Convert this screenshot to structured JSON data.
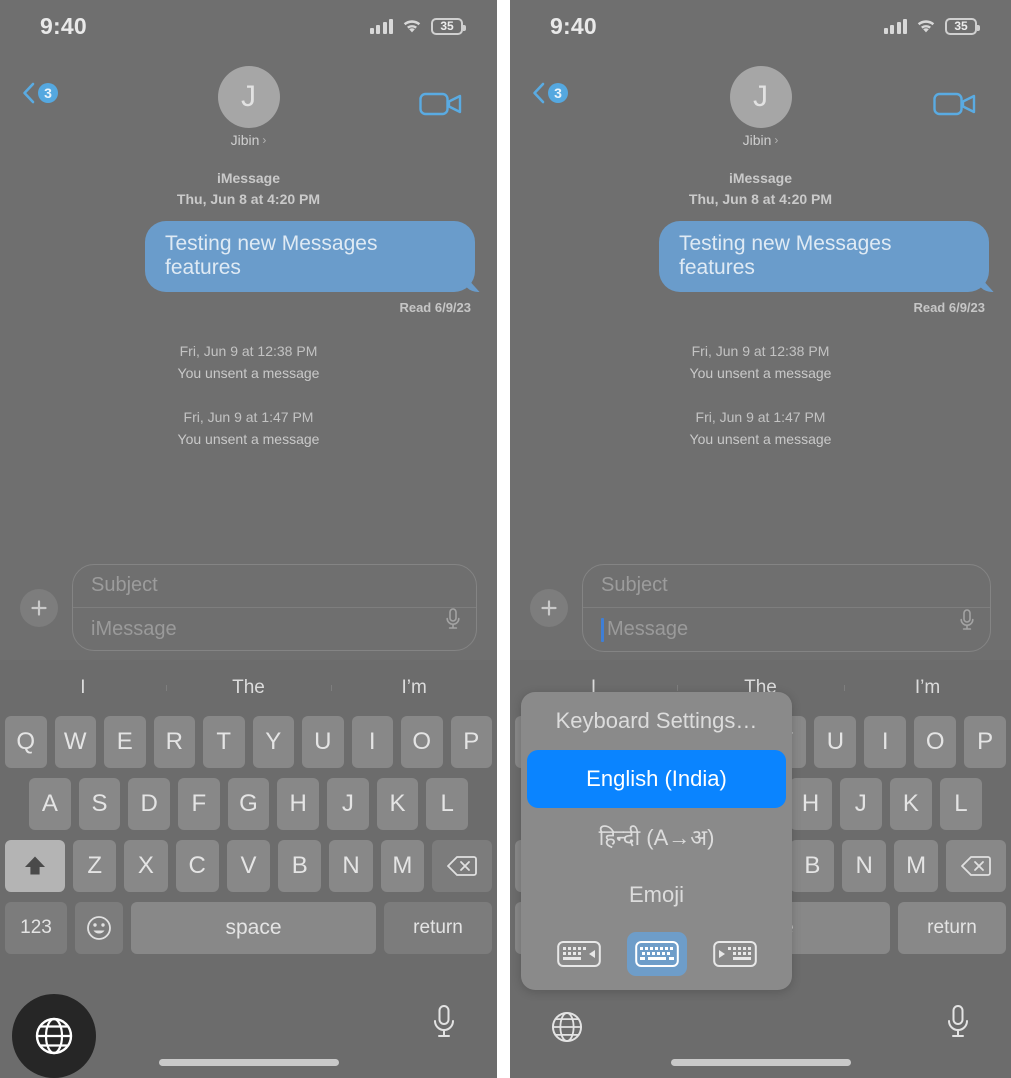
{
  "status_bar": {
    "time": "9:40",
    "battery_level": "35",
    "signal_icon": "cellular-signal-icon",
    "wifi_icon": "wifi-icon",
    "battery_icon": "battery-icon"
  },
  "nav_bar": {
    "back_icon": "chevron-left-icon",
    "unread_count": "3",
    "avatar_initial": "J",
    "contact_name": "Jibin",
    "contact_chevron": "›",
    "facetime_icon": "video-camera-icon"
  },
  "conversation": {
    "service_label": "iMessage",
    "service_timestamp": "Thu, Jun 8 at 4:20 PM",
    "sent_message": "Testing new Messages features",
    "read_receipt": "Read 6/9/23",
    "unsent_events": [
      {
        "timestamp": "Fri, Jun 9 at 12:38 PM",
        "text": "You unsent a message"
      },
      {
        "timestamp": "Fri, Jun 9 at 1:47 PM",
        "text": "You unsent a message"
      }
    ]
  },
  "composer": {
    "plus_icon": "plus-icon",
    "subject_placeholder": "Subject",
    "message_placeholder": "iMessage",
    "message_placeholder_focused": "Message",
    "mic_icon": "microphone-icon"
  },
  "keyboard": {
    "predictions": [
      "I",
      "The",
      "I’m"
    ],
    "row1": [
      "Q",
      "W",
      "E",
      "R",
      "T",
      "Y",
      "U",
      "I",
      "O",
      "P"
    ],
    "row2": [
      "A",
      "S",
      "D",
      "F",
      "G",
      "H",
      "J",
      "K",
      "L"
    ],
    "row3": [
      "Z",
      "X",
      "C",
      "V",
      "B",
      "N",
      "M"
    ],
    "shift_icon": "shift-arrow-icon",
    "backspace_icon": "backspace-delete-icon",
    "numbers_key": "123",
    "emoji_key_icon": "emoji-smiley-icon",
    "space_key": "space",
    "return_key": "return",
    "globe_icon": "globe-language-icon",
    "mic_icon": "microphone-icon",
    "home_indicator": "home-indicator-bar"
  },
  "language_popup": {
    "settings_item": "Keyboard Settings…",
    "selected_language": "English (India)",
    "other_language": "हिन्दी (A→अ)",
    "emoji_item": "Emoji",
    "layouts": [
      {
        "name": "keyboard-dock-left-icon",
        "active": false
      },
      {
        "name": "keyboard-dock-full-icon",
        "active": true
      },
      {
        "name": "keyboard-dock-right-icon",
        "active": false
      }
    ]
  },
  "colors": {
    "accent_blue": "#0a84ff",
    "bubble_blue": "#6a9ccb",
    "panel_background": "#6f6f6f",
    "keyboard_background": "#6c6c6c",
    "key_background": "#888888",
    "popup_background": "#8a8a8a",
    "globe_highlight": "#262626"
  },
  "panels": [
    {
      "id": "left",
      "name": "step-1-tap-globe",
      "popup_visible": false,
      "globe_highlighted": true
    },
    {
      "id": "right",
      "name": "step-2-language-popup",
      "popup_visible": true,
      "globe_highlighted": false
    }
  ]
}
